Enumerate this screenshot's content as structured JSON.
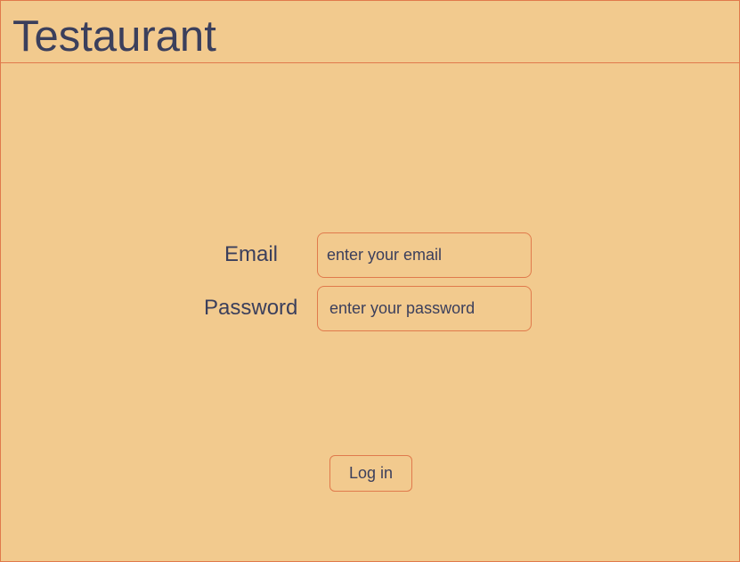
{
  "header": {
    "title": "Testaurant"
  },
  "login_form": {
    "email_label": "Email",
    "email_value": "",
    "email_placeholder": "enter your email",
    "password_label": "Password",
    "password_value": "",
    "password_placeholder": "enter your password",
    "submit_label": "Log in"
  },
  "colors": {
    "background": "#f2ca8e",
    "border": "#e07a4c",
    "text": "#3b3f5c"
  }
}
